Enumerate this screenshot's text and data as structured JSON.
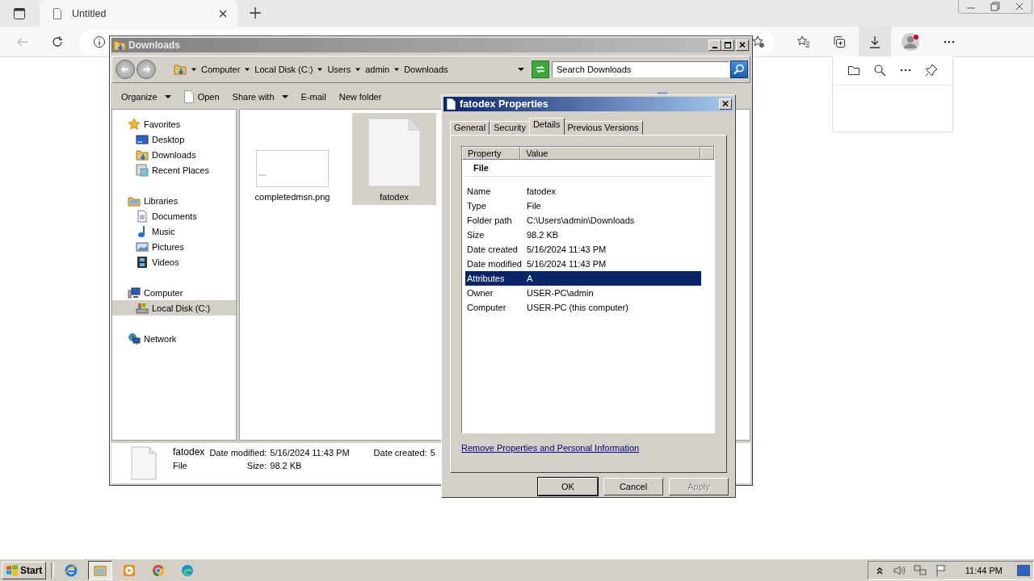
{
  "browser": {
    "tab": {
      "title": "Untitled"
    }
  },
  "explorer": {
    "title": "Downloads",
    "breadcrumb": [
      "Computer",
      "Local Disk (C:)",
      "Users",
      "admin",
      "Downloads"
    ],
    "search": {
      "placeholder": "Search Downloads"
    },
    "toolbar": [
      {
        "label": "Organize",
        "kind": "menu"
      },
      {
        "label": "Open",
        "kind": "file"
      },
      {
        "label": "Share with",
        "kind": "menu"
      },
      {
        "label": "E-mail",
        "kind": "plain"
      },
      {
        "label": "New folder",
        "kind": "plain"
      }
    ],
    "nav": [
      {
        "label": "Favorites",
        "kind": "star",
        "selected": false,
        "children": [
          {
            "label": "Desktop",
            "kind": "desktop",
            "selected": false
          },
          {
            "label": "Downloads",
            "kind": "downloads",
            "selected": false
          },
          {
            "label": "Recent Places",
            "kind": "recent",
            "selected": false
          }
        ]
      },
      {
        "label": "Libraries",
        "kind": "library",
        "selected": false,
        "children": [
          {
            "label": "Documents",
            "kind": "documents",
            "selected": false
          },
          {
            "label": "Music",
            "kind": "music",
            "selected": false
          },
          {
            "label": "Pictures",
            "kind": "pictures",
            "selected": false
          },
          {
            "label": "Videos",
            "kind": "videos",
            "selected": false
          }
        ]
      },
      {
        "label": "Computer",
        "kind": "computer",
        "selected": false,
        "children": [
          {
            "label": "Local Disk (C:)",
            "kind": "disk",
            "selected": true
          }
        ]
      },
      {
        "label": "Network",
        "kind": "network",
        "selected": false
      }
    ],
    "files": [
      {
        "name": "completedmsn.png",
        "kind": "image",
        "selected": false
      },
      {
        "name": "fatodex",
        "kind": "blank",
        "selected": true
      }
    ],
    "details_pane": {
      "name": "fatodex",
      "type": "File",
      "fields": [
        {
          "label": "Date modified:",
          "value": "5/16/2024 11:43 PM"
        },
        {
          "label": "Size:",
          "value": "98.2 KB"
        },
        {
          "label": "Date created:",
          "value": "5"
        }
      ]
    }
  },
  "properties": {
    "title": "fatodex Properties",
    "tabs": [
      {
        "label": "General",
        "selected": false
      },
      {
        "label": "Security",
        "selected": false
      },
      {
        "label": "Details",
        "selected": true
      },
      {
        "label": "Previous Versions",
        "selected": false
      }
    ],
    "columns": [
      "Property",
      "Value"
    ],
    "group": "File",
    "rows": [
      {
        "property": "Name",
        "value": "fatodex",
        "selected": false
      },
      {
        "property": "Type",
        "value": "File",
        "selected": false
      },
      {
        "property": "Folder path",
        "value": "C:\\Users\\admin\\Downloads",
        "selected": false
      },
      {
        "property": "Size",
        "value": "98.2 KB",
        "selected": false
      },
      {
        "property": "Date created",
        "value": "5/16/2024 11:43 PM",
        "selected": false
      },
      {
        "property": "Date modified",
        "value": "5/16/2024 11:43 PM",
        "selected": false
      },
      {
        "property": "Attributes",
        "value": "A",
        "selected": true
      },
      {
        "property": "Owner",
        "value": "USER-PC\\admin",
        "selected": false
      },
      {
        "property": "Computer",
        "value": "USER-PC (this computer)",
        "selected": false
      }
    ],
    "link": "Remove Properties and Personal Information",
    "buttons": [
      {
        "label": "OK",
        "default": true,
        "disabled": false
      },
      {
        "label": "Cancel",
        "default": false,
        "disabled": false
      },
      {
        "label": "Apply",
        "default": false,
        "disabled": true
      }
    ]
  },
  "taskbar": {
    "start": "Start",
    "apps": [
      {
        "kind": "ie",
        "active": false
      },
      {
        "kind": "explorer",
        "active": true
      },
      {
        "kind": "media",
        "active": false
      },
      {
        "kind": "chrome",
        "active": false
      },
      {
        "kind": "edge",
        "active": false
      }
    ],
    "clock": "11:44 PM"
  }
}
